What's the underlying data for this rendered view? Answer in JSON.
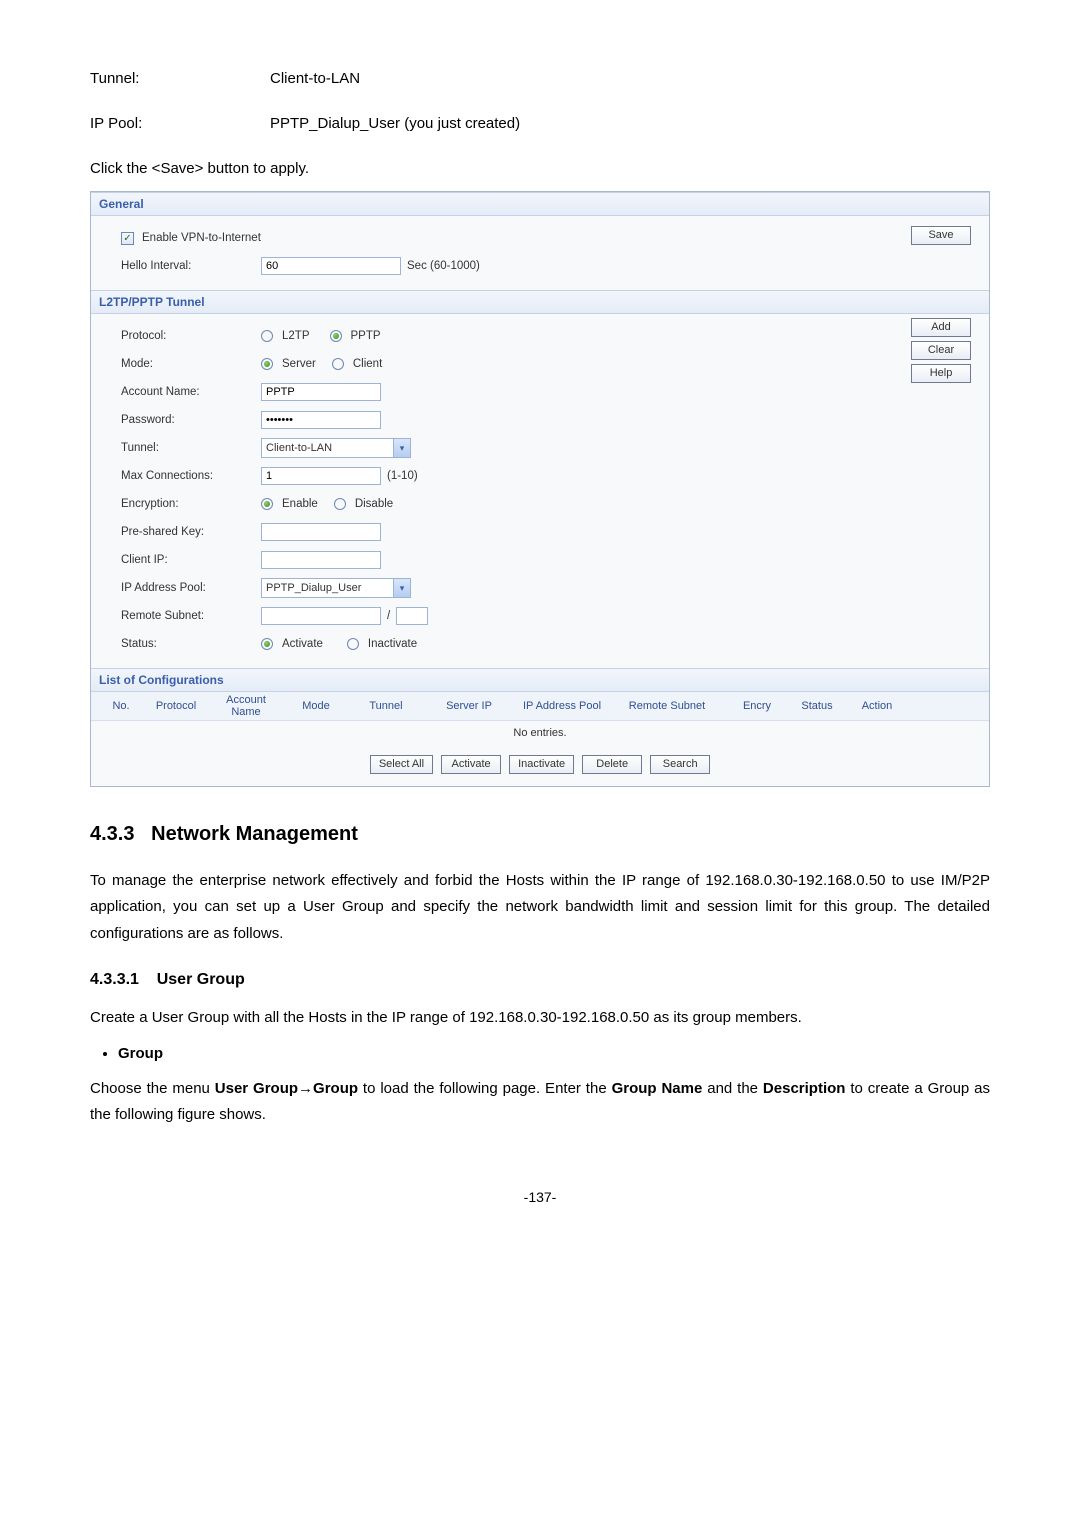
{
  "intro": {
    "tunnel_label": "Tunnel:",
    "tunnel_value": "Client-to-LAN",
    "ippool_label": "IP Pool:",
    "ippool_value": "PPTP_Dialup_User (you just created)",
    "note": "Click the <Save> button to apply."
  },
  "panel": {
    "general": {
      "heading": "General",
      "enable_label": "Enable VPN-to-Internet",
      "save_btn": "Save",
      "hello_label": "Hello Interval:",
      "hello_value": "60",
      "hello_hint": "Sec (60-1000)"
    },
    "tunnel": {
      "heading": "L2TP/PPTP Tunnel",
      "add_btn": "Add",
      "clear_btn": "Clear",
      "help_btn": "Help",
      "protocol_label": "Protocol:",
      "protocol_l2tp": "L2TP",
      "protocol_pptp": "PPTP",
      "mode_label": "Mode:",
      "mode_server": "Server",
      "mode_client": "Client",
      "account_label": "Account Name:",
      "account_value": "PPTP",
      "password_label": "Password:",
      "password_value": "•••••••",
      "tunnel_label": "Tunnel:",
      "tunnel_value": "Client-to-LAN",
      "maxconn_label": "Max Connections:",
      "maxconn_value": "1",
      "maxconn_hint": "(1-10)",
      "encryption_label": "Encryption:",
      "encryption_enable": "Enable",
      "encryption_disable": "Disable",
      "psk_label": "Pre-shared Key:",
      "clientip_label": "Client IP:",
      "ippool_label": "IP Address Pool:",
      "ippool_value": "PPTP_Dialup_User",
      "remotesubnet_label": "Remote Subnet:",
      "remotesubnet_sep": "/",
      "status_label": "Status:",
      "status_activate": "Activate",
      "status_inactivate": "Inactivate"
    },
    "list": {
      "heading": "List of Configurations",
      "cols": {
        "no": "No.",
        "protocol": "Protocol",
        "account": "Account Name",
        "mode": "Mode",
        "tunnel": "Tunnel",
        "serverip": "Server IP",
        "ippool": "IP Address Pool",
        "remotesubnet": "Remote Subnet",
        "encry": "Encry",
        "status": "Status",
        "action": "Action"
      },
      "no_entries": "No entries.",
      "btns": {
        "select_all": "Select All",
        "activate": "Activate",
        "inactivate": "Inactivate",
        "delete": "Delete",
        "search": "Search"
      }
    }
  },
  "section": {
    "num": "4.3.3",
    "title": "Network Management",
    "para": "To manage the enterprise network effectively and forbid the Hosts within the IP range of 192.168.0.30-192.168.0.50 to use IM/P2P application, you can set up a User Group and specify the network bandwidth limit and session limit for this group. The detailed configurations are as follows.",
    "sub_num": "4.3.3.1",
    "sub_title": "User Group",
    "sub_para": "Create a User Group with all the Hosts in the IP range of 192.168.0.30-192.168.0.50 as its group members.",
    "bullet": "Group",
    "bullet_para_pre": "Choose the menu ",
    "bullet_bold1": "User Group→Group",
    "bullet_para_mid": " to load the following page. Enter the ",
    "bullet_bold2": "Group Name",
    "bullet_para_mid2": " and the ",
    "bullet_bold3": "Description",
    "bullet_para_end": " to create a Group as the following figure shows."
  },
  "page_num": "-137-"
}
